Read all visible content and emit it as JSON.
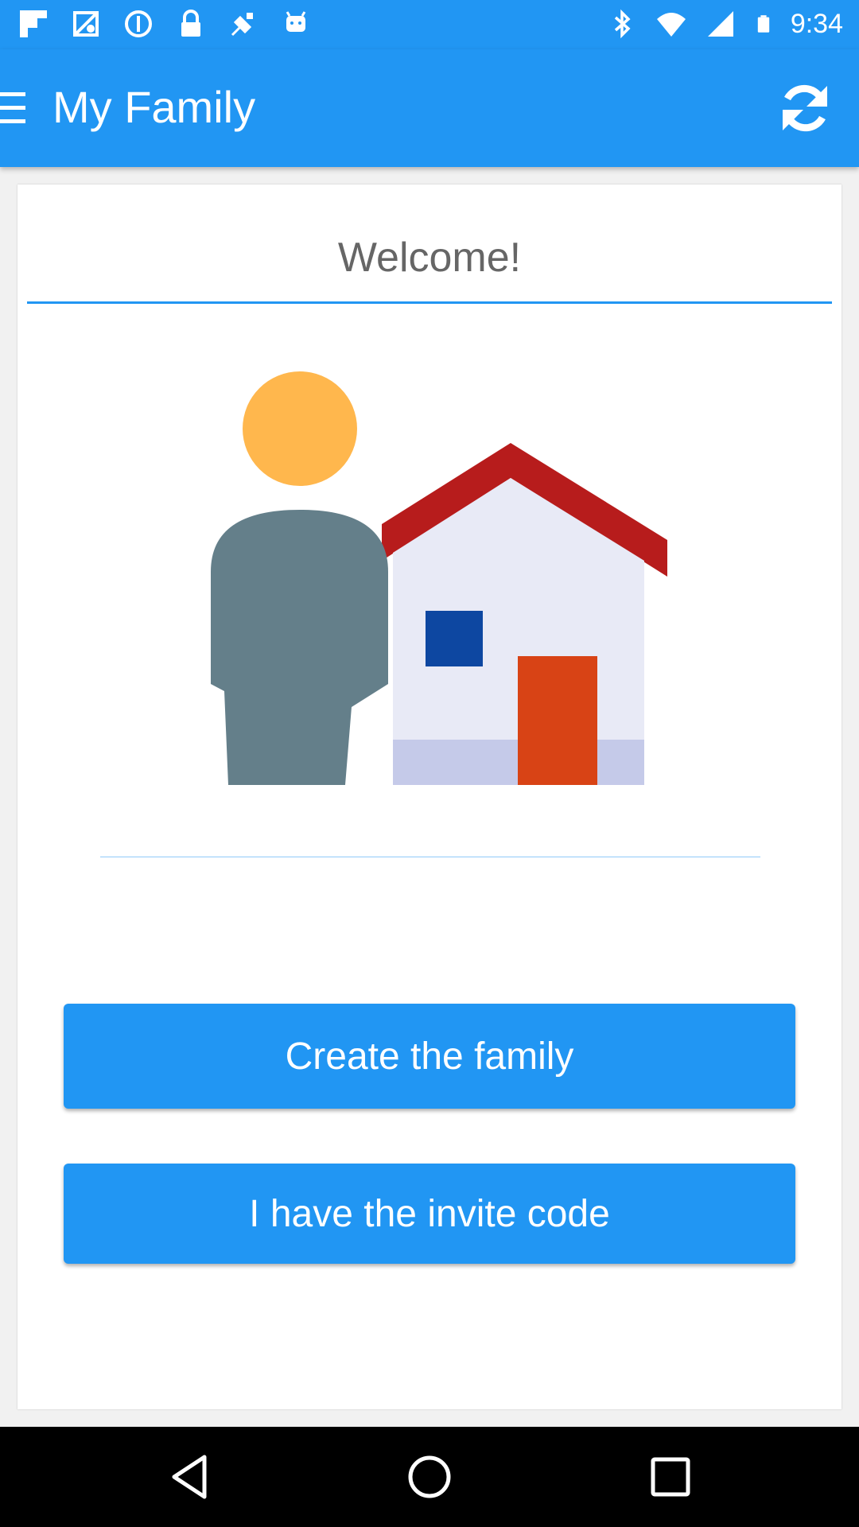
{
  "status_bar": {
    "time": "9:34",
    "left_icons": [
      "flipboard-icon",
      "maps-icon",
      "data-saver-icon",
      "lock-icon",
      "fake-gps-icon",
      "android-icon"
    ],
    "right_icons": [
      "bluetooth-icon",
      "wifi-icon",
      "signal-icon",
      "battery-icon"
    ]
  },
  "app_bar": {
    "title": "My Family",
    "menu_icon": "menu-icon",
    "refresh_icon": "refresh-icon"
  },
  "welcome": {
    "title": "Welcome!"
  },
  "illustration": {
    "name": "person-with-house",
    "colors": {
      "head": "#ffb74d",
      "body": "#647f8a",
      "roof": "#b71c1c",
      "wall": "#e8eaf6",
      "window": "#0d47a1",
      "door": "#d84315",
      "ground": "#c5cae9"
    }
  },
  "buttons": {
    "create": "Create the family",
    "invite": "I have the invite code"
  },
  "nav_bar": {
    "icons": [
      "back-icon",
      "home-icon",
      "recents-icon"
    ]
  },
  "colors": {
    "primary": "#2196f3",
    "text_muted": "#666666"
  }
}
